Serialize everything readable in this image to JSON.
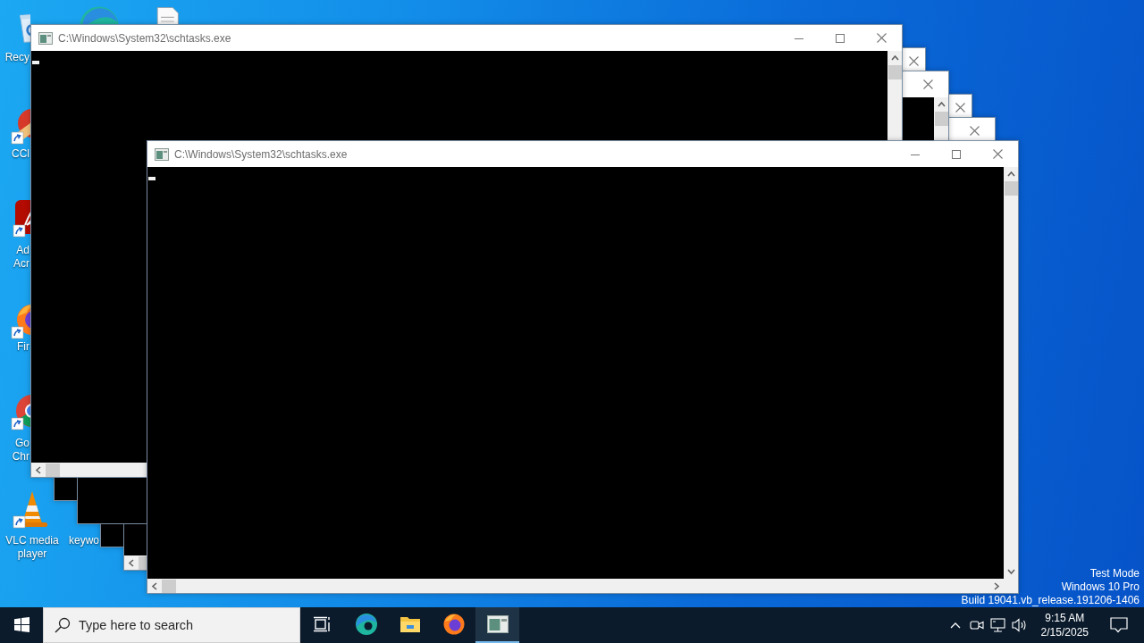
{
  "desktop": {
    "icons": [
      {
        "kind": "recycle-bin",
        "label": "Recy"
      },
      {
        "kind": "edge"
      },
      {
        "kind": "file"
      },
      {
        "kind": "ccleaner",
        "label": "CCl"
      },
      {
        "kind": "acrobat",
        "label": "Ad Acr"
      },
      {
        "kind": "firefox",
        "label": "Fir"
      },
      {
        "kind": "chrome",
        "label": "Go Chr"
      },
      {
        "kind": "vlc",
        "label": "VLC media player"
      },
      {
        "kind": "document",
        "label": "keywo"
      }
    ],
    "system_info": [
      "Test Mode",
      "Windows 10 Pro",
      "Build 19041.vb_release.191206-1406"
    ]
  },
  "windows": [
    {
      "horizontal_scrollbar": false
    },
    {
      "horizontal_scrollbar": true
    },
    {
      "horizontal_scrollbar": false
    },
    {
      "vertical_scrollbar": true,
      "horizontal_scrollbar": false
    },
    {
      "title": "C:\\Windows\\System32\\schtasks.exe",
      "vertical_scrollbar": true,
      "horizontal_scrollbar": true,
      "cursor": true
    },
    {
      "title": "C:\\Windows\\System32\\schtasks.exe",
      "vertical_scrollbar": true,
      "horizontal_scrollbar": true,
      "cursor": true
    }
  ],
  "taskbar": {
    "items": [
      {
        "kind": "start"
      },
      {
        "kind": "search",
        "placeholder": "Type here to search"
      },
      {
        "kind": "task-view"
      },
      {
        "kind": "edge"
      },
      {
        "kind": "explorer"
      },
      {
        "kind": "firefox"
      },
      {
        "kind": "console",
        "running": true
      }
    ],
    "tray": [
      {
        "kind": "chevron"
      },
      {
        "kind": "camera"
      },
      {
        "kind": "network"
      },
      {
        "kind": "volume"
      }
    ],
    "clock": {
      "time": "9:15 AM",
      "date": "2/15/2025"
    }
  }
}
